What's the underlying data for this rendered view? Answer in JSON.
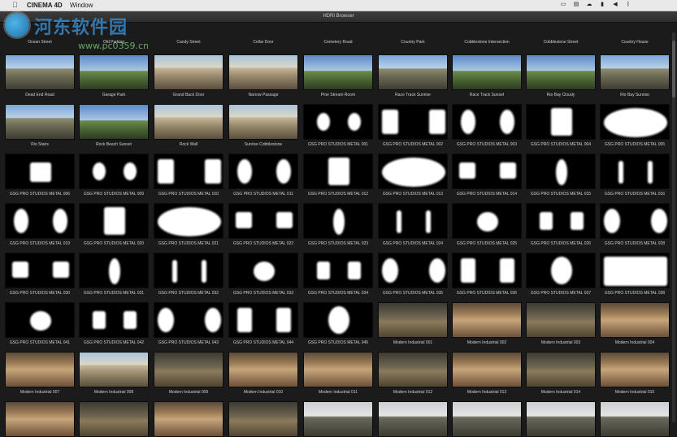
{
  "menubar": {
    "apple": "",
    "app": "CINEMA 4D",
    "window": "Window",
    "status_icons": [
      "screen-icon",
      "cast-icon",
      "cloud-icon",
      "battery-icon",
      "volume-icon",
      "bluetooth-icon"
    ]
  },
  "watermark": {
    "title": "河东软件园",
    "url": "www.pc0359.cn"
  },
  "window": {
    "title": "HDRI Browser"
  },
  "top_labels": [
    "Ocean Street",
    "Old Parking",
    "Candy Street",
    "Cellar Door",
    "Cemetery Road",
    "Country Park",
    "Cobblestone Intersection",
    "Cobblestone Street",
    "Country House"
  ],
  "rows": [
    {
      "labels": [
        "Dead End Road",
        "Garage Park",
        "Grand Back Door",
        "Narrow Passage",
        "Pine Stream Room",
        "Race Track Sunrise",
        "Race Track Sunset",
        "Rio Bay Cloudy",
        "Rio Bay Sunrise"
      ],
      "kinds": [
        "photo-sky",
        "photo-field",
        "photo-house",
        "photo-house",
        "photo-field",
        "photo-sky",
        "photo-field",
        "photo-field",
        "photo-sky"
      ]
    },
    {
      "labels": [
        "Rio Stairs",
        "Rock Beach Sunset",
        "Rock Wall",
        "Sunrise Cobblestone",
        "GSG PRO STUDIOS METAL 001",
        "GSG PRO STUDIOS METAL 002",
        "GSG PRO STUDIOS METAL 003",
        "GSG PRO STUDIOS METAL 004",
        "GSG PRO STUDIOS METAL 005"
      ],
      "kinds": [
        "photo-sky",
        "photo-field",
        "photo-house",
        "photo-house",
        "studio",
        "studio",
        "studio",
        "studio",
        "studio"
      ]
    },
    {
      "labels": [
        "GSG PRO STUDIOS METAL 006",
        "GSG PRO STUDIOS METAL 009",
        "GSG PRO STUDIOS METAL 010",
        "GSG PRO STUDIOS METAL 011",
        "GSG PRO STUDIOS METAL 012",
        "GSG PRO STUDIOS METAL 013",
        "GSG PRO STUDIOS METAL 014",
        "GSG PRO STUDIOS METAL 015",
        "GSG PRO STUDIOS METAL 016"
      ],
      "kinds": [
        "studio",
        "studio",
        "studio",
        "studio",
        "studio",
        "studio",
        "studio",
        "studio",
        "studio"
      ]
    },
    {
      "labels": [
        "GSG PRO STUDIOS METAL 019",
        "GSG PRO STUDIOS METAL 020",
        "GSG PRO STUDIOS METAL 021",
        "GSG PRO STUDIOS METAL 022",
        "GSG PRO STUDIOS METAL 023",
        "GSG PRO STUDIOS METAL 024",
        "GSG PRO STUDIOS METAL 025",
        "GSG PRO STUDIOS METAL 026",
        "GSG PRO STUDIOS METAL 028"
      ],
      "kinds": [
        "studio",
        "studio",
        "studio",
        "studio",
        "studio",
        "studio",
        "studio",
        "studio",
        "studio"
      ]
    },
    {
      "labels": [
        "GSG PRO STUDIOS METAL 030",
        "GSG PRO STUDIOS METAL 031",
        "GSG PRO STUDIOS METAL 032",
        "GSG PRO STUDIOS METAL 033",
        "GSG PRO STUDIOS METAL 034",
        "GSG PRO STUDIOS METAL 035",
        "GSG PRO STUDIOS METAL 036",
        "GSG PRO STUDIOS METAL 037",
        "GSG PRO STUDIOS METAL 038"
      ],
      "kinds": [
        "studio",
        "studio",
        "studio",
        "studio",
        "studio",
        "studio",
        "studio",
        "studio",
        "studio"
      ]
    },
    {
      "labels": [
        "GSG PRO STUDIOS METAL 041",
        "GSG PRO STUDIOS METAL 042",
        "GSG PRO STUDIOS METAL 043",
        "GSG PRO STUDIOS METAL 044",
        "GSG PRO STUDIOS METAL 045",
        "Modern Industrial 001",
        "Modern Industrial 002",
        "Modern Industrial 003",
        "Modern Industrial 004"
      ],
      "kinds": [
        "studio",
        "studio",
        "studio",
        "studio",
        "studio",
        "photo-dark",
        "photo-warm",
        "photo-dark",
        "photo-warm"
      ]
    },
    {
      "labels": [
        "Modern Industrial 007",
        "Modern Industrial 008",
        "Modern Industrial 009",
        "Modern Industrial 010",
        "Modern Industrial 011",
        "Modern Industrial 012",
        "Modern Industrial 013",
        "Modern Industrial 014",
        "Modern Industrial 015"
      ],
      "kinds": [
        "photo-warm",
        "photo-house",
        "photo-dark",
        "photo-warm",
        "photo-warm",
        "photo-dark",
        "photo-warm",
        "photo-dark",
        "photo-warm"
      ]
    },
    {
      "labels": [
        "",
        "",
        "",
        "",
        "",
        "",
        "",
        "",
        ""
      ],
      "kinds": [
        "photo-warm",
        "photo-dark",
        "photo-warm",
        "photo-dark",
        "photo-forest",
        "photo-forest",
        "photo-forest",
        "photo-forest",
        "photo-forest"
      ]
    }
  ]
}
